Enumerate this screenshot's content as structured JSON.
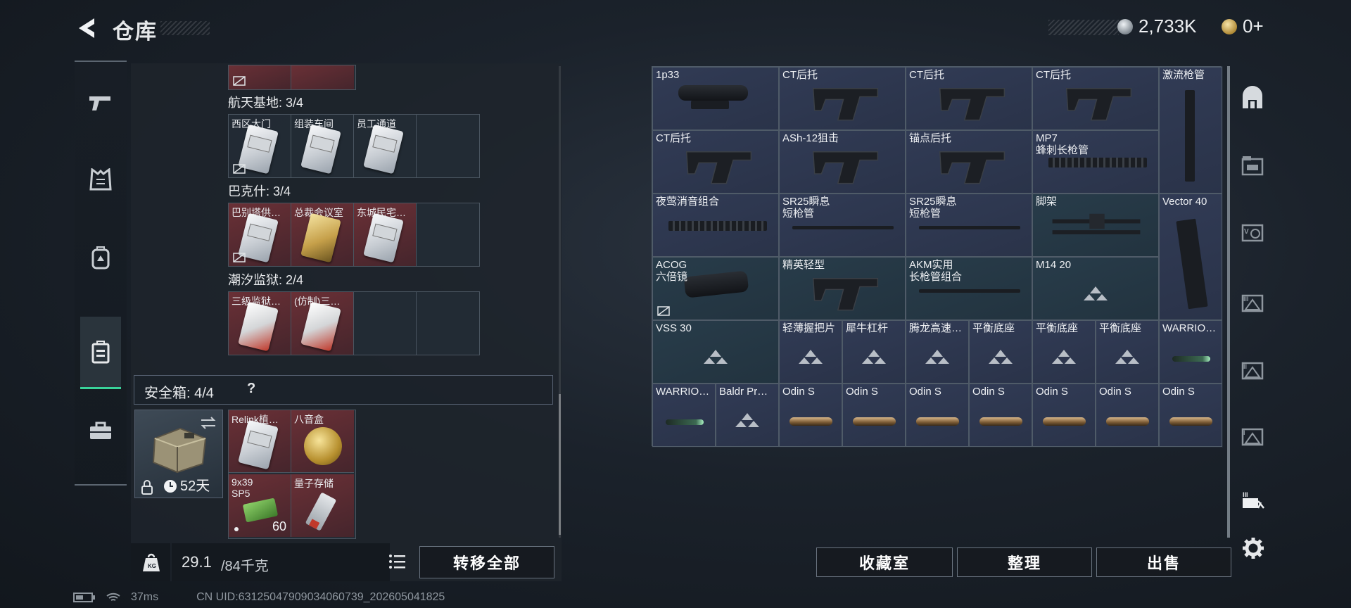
{
  "header": {
    "title": "仓库",
    "currency_silver": "2,733K",
    "currency_gold": "0+"
  },
  "left_nav": {
    "items": [
      {
        "name": "pistol-icon"
      },
      {
        "name": "armor-icon"
      },
      {
        "name": "backpack-icon"
      },
      {
        "name": "safe-case-icon",
        "active": true
      },
      {
        "name": "toolbox-icon"
      }
    ]
  },
  "stash": {
    "sections": [
      {
        "label": "航天基地: 3/4",
        "cells": [
          {
            "label": "西区大门",
            "style": "plain",
            "card": "white",
            "noswap": true
          },
          {
            "label": "组装车间",
            "style": "plain",
            "card": "white",
            "noswap": false
          },
          {
            "label": "员工通道",
            "style": "plain",
            "card": "white",
            "noswap": false
          },
          {
            "label": "",
            "style": "plain",
            "card": "",
            "noswap": false
          }
        ]
      },
      {
        "label": "巴克什: 3/4",
        "cells": [
          {
            "label": "巴别塔供…",
            "style": "red",
            "card": "white",
            "noswap": true
          },
          {
            "label": "总裁会议室",
            "style": "red",
            "card": "gold",
            "noswap": false
          },
          {
            "label": "东城民宅…",
            "style": "red",
            "card": "white",
            "noswap": false
          },
          {
            "label": "",
            "style": "plain",
            "card": "",
            "noswap": false
          }
        ]
      },
      {
        "label": "潮汐监狱: 2/4",
        "cells": [
          {
            "label": "三级监狱…",
            "style": "red",
            "card": "redc",
            "noswap": false
          },
          {
            "label": "(仿制)三…",
            "style": "red",
            "card": "redc",
            "noswap": false
          },
          {
            "label": "",
            "style": "plain",
            "card": "",
            "noswap": false
          },
          {
            "label": "",
            "style": "plain",
            "card": "",
            "noswap": false
          }
        ]
      }
    ]
  },
  "safe_box": {
    "label": "安全箱: 4/4",
    "help": "?",
    "days": "52天",
    "items": [
      {
        "label": "Relink植…"
      },
      {
        "label": "八音盒"
      },
      {
        "label": "9x39\nSP5",
        "count": "60"
      },
      {
        "label": "量子存储"
      }
    ]
  },
  "bottom": {
    "weight_current": "29.1",
    "weight_max": "/84千克",
    "transfer_all": "转移全部"
  },
  "right_grid": {
    "items": [
      {
        "label": "1p33"
      },
      {
        "label": "CT后托"
      },
      {
        "label": "CT后托"
      },
      {
        "label": "CT后托"
      },
      {
        "label": "激流枪管"
      },
      {
        "label": "CT后托"
      },
      {
        "label": "ASh-12狙击"
      },
      {
        "label": "锚点后托"
      },
      {
        "label": "MP7\n蜂刺长枪管"
      },
      {
        "label": "夜莺消音组合"
      },
      {
        "label": "SR25瞬息\n短枪管"
      },
      {
        "label": "SR25瞬息\n短枪管"
      },
      {
        "label": "脚架"
      },
      {
        "label": "Vector 40"
      },
      {
        "label": "ACOG\n六倍镜"
      },
      {
        "label": "精英轻型"
      },
      {
        "label": "AKM实用\n长枪管组合"
      },
      {
        "label": "M14 20"
      },
      {
        "label": "VSS 30"
      },
      {
        "label": "轻薄握把片"
      },
      {
        "label": "犀牛杠杆"
      },
      {
        "label": "腾龙高速…"
      },
      {
        "label": "平衡底座"
      },
      {
        "label": "平衡底座"
      },
      {
        "label": "平衡底座"
      },
      {
        "label": "WARRIO…"
      },
      {
        "label": "WARRIO…"
      },
      {
        "label": "Baldr Pr…"
      },
      {
        "label": "Odin S"
      },
      {
        "label": "Odin S"
      },
      {
        "label": "Odin S"
      },
      {
        "label": "Odin S"
      },
      {
        "label": "Odin S"
      },
      {
        "label": "Odin S"
      },
      {
        "label": "Odin S"
      }
    ]
  },
  "actions": {
    "collection": "收藏室",
    "sort": "整理",
    "sell": "出售"
  },
  "status": {
    "ping": "37ms",
    "uid": "CN UID:63125047909034060739_202605041825"
  }
}
